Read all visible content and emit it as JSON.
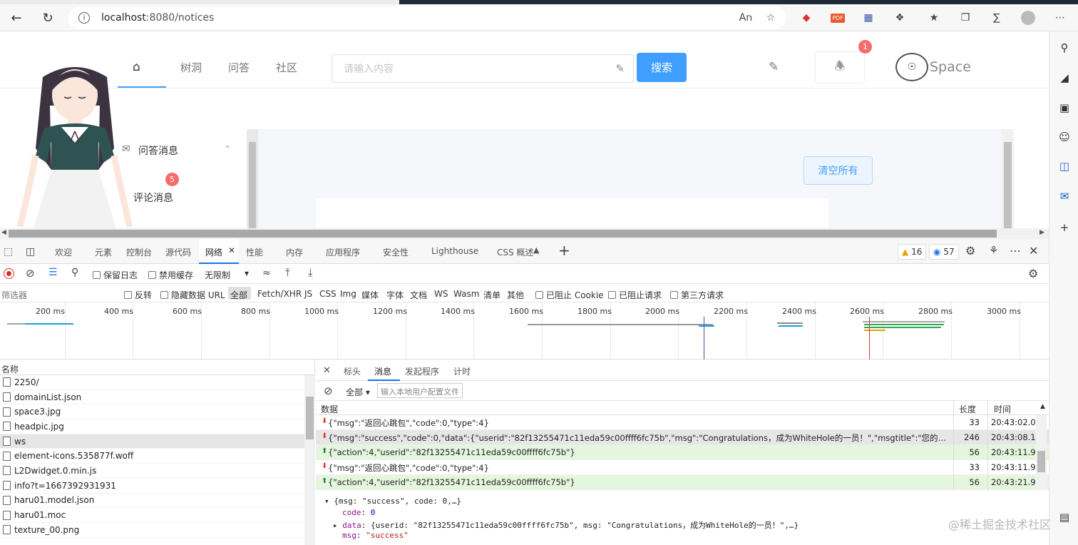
{
  "browser": {
    "url_host": "localhost",
    "url_rest": ":8080/notices"
  },
  "site": {
    "nav": [
      "树洞",
      "问答",
      "社区"
    ],
    "search_placeholder": "请输入内容",
    "search_button": "搜索",
    "notification_count": "1",
    "logo_text": "Space",
    "menu_qa": "问答消息",
    "menu_comment": "评论消息",
    "comment_badge": "5",
    "clear_all": "清空所有"
  },
  "devtools": {
    "tabs": [
      "欢迎",
      "元素",
      "控制台",
      "源代码",
      "网络",
      "性能",
      "内存",
      "应用程序",
      "安全性",
      "Lighthouse",
      "CSS 概述"
    ],
    "warnings": "16",
    "issues": "57",
    "preserve_log": "保留日志",
    "disable_cache": "禁用缓存",
    "throttle": "无限制",
    "filter_placeholder": "筛选器",
    "invert": "反转",
    "hide_data_urls": "隐藏数据 URL",
    "type_filters": [
      "全部",
      "Fetch/XHR",
      "JS",
      "CSS",
      "Img",
      "媒体",
      "字体",
      "文档",
      "WS",
      "Wasm",
      "清单",
      "其他"
    ],
    "blocked_cookies": "已阻止 Cookie",
    "blocked_requests": "已阻止请求",
    "third_party": "第三方请求",
    "timeline_ticks": [
      "200 ms",
      "400 ms",
      "600 ms",
      "800 ms",
      "1000 ms",
      "1200 ms",
      "1400 ms",
      "1600 ms",
      "1800 ms",
      "2000 ms",
      "2200 ms",
      "2400 ms",
      "2600 ms",
      "2800 ms",
      "3000 ms"
    ],
    "name_header": "名称",
    "requests": [
      "2250/",
      "domainList.json",
      "space3.jpg",
      "headpic.jpg",
      "ws",
      "element-icons.535877f.woff",
      "L2Dwidget.0.min.js",
      "info?t=1667392931931",
      "haru01.model.json",
      "haru01.moc",
      "texture_00.png"
    ],
    "detail_tabs": [
      "标头",
      "消息",
      "发起程序",
      "计时"
    ],
    "msg_filter_value": "全部",
    "msg_filter_placeholder": "输入本地用户配置文件",
    "col_data": "数据",
    "col_length": "长度",
    "col_time": "时间",
    "messages": [
      {
        "dir": "recv",
        "data": "{\"msg\":\"返回心跳包\",\"code\":0,\"type\":4}",
        "length": "33",
        "time": "20:43:02.0..."
      },
      {
        "dir": "recv",
        "data": "{\"msg\":\"success\",\"code\":0,\"data\":{\"userid\":\"82f13255471c11eda59c00ffff6fc75b\",\"msg\":\"Congratulations，成为WhiteHole的一员！\",\"msgtitle\":\"您的申请已经通过\",\"lin...",
        "length": "246",
        "time": "20:43:08.1..."
      },
      {
        "dir": "sent",
        "data": "{\"action\":4,\"userid\":\"82f13255471c11eda59c00ffff6fc75b\"}",
        "length": "56",
        "time": "20:43:11.9..."
      },
      {
        "dir": "recv",
        "data": "{\"msg\":\"返回心跳包\",\"code\":0,\"type\":4}",
        "length": "33",
        "time": "20:43:11.9..."
      },
      {
        "dir": "sent",
        "data": "{\"action\":4,\"userid\":\"82f13255471c11eda59c00ffff6fc75b\"}",
        "length": "56",
        "time": "20:43:21.9..."
      }
    ],
    "detail_preview": "{msg: \"success\", code: 0,…}",
    "detail_code_key": "code",
    "detail_code_val": "0",
    "detail_data_key": "data",
    "detail_data_val": "{userid: \"82f13255471c11eda59c00ffff6fc75b\", msg: \"Congratulations，成为WhiteHole的一员！\",…}",
    "detail_msg_key": "msg",
    "detail_msg_val": "\"success\""
  },
  "watermark": "@稀土掘金技术社区",
  "colors": {
    "accent": "#409eff",
    "badge": "#f56c6c",
    "sent_row": "#e4f7de"
  }
}
